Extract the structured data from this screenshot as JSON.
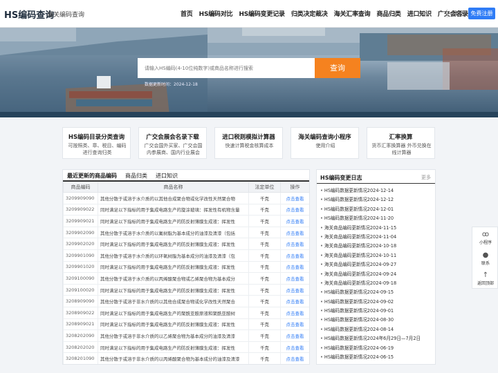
{
  "header": {
    "logo": "HS编码查询",
    "subtitle": "海关编码查询",
    "nav": [
      "首页",
      "HS编码对比",
      "HS编码变更记录",
      "归类决定裁决",
      "海关汇率查询",
      "商品归类",
      "进口知识",
      "广交会名录"
    ],
    "login": "登录",
    "register": "免费注册"
  },
  "hero": {
    "search_placeholder": "请输入HS编码(4-10位纯数字)或商品名称进行搜索",
    "search_button": "查询",
    "update_time": "数据更新时间：2024-12-18"
  },
  "cards": [
    {
      "title": "HS编码目录分类查询",
      "desc": "可按照类、章、税目、编码进行查询归类"
    },
    {
      "title": "广交会展会名录下载",
      "desc": "广交会国外买家、广交会国内参展商、国内行业展会"
    },
    {
      "title": "进口税则模拟计算器",
      "desc": "快速计算税金核算成本"
    },
    {
      "title": "海关编码查询小程序",
      "desc": "使用介绍"
    },
    {
      "title": "汇率换算",
      "desc": "货币汇率换算器 外币兑换在线计算器"
    }
  ],
  "products": {
    "tabs": [
      "最近更新的商品编码",
      "商品归类",
      "进口知识"
    ],
    "columns": [
      "商品编码",
      "商品名称",
      "法定单位",
      "操作"
    ],
    "rows": [
      {
        "code": "3209909090",
        "name": "其他分散于或溶于水介质的以其他合成聚合物或化学改性天然聚合物",
        "unit": "千克",
        "op": "点击查看"
      },
      {
        "code": "3209909022",
        "name": "同时满足以下指标的用于集成电路生产的旋涂玻璃：挥发性有机物含量",
        "unit": "千克",
        "op": "点击查看"
      },
      {
        "code": "3209909021",
        "name": "同时满足以下指标的用于集成电路生产的防反射薄膜生成液：挥发性",
        "unit": "千克",
        "op": "点击查看"
      },
      {
        "code": "3209902090",
        "name": "其他分散于或溶于水介质的以氟树脂为基本成分的油漆及清漆（包括",
        "unit": "千克",
        "op": "点击查看"
      },
      {
        "code": "3209902020",
        "name": "同时满足以下指标的用于集成电路生产的防反射薄膜生成液：挥发性",
        "unit": "千克",
        "op": "点击查看"
      },
      {
        "code": "3209901090",
        "name": "其他分散于或溶于水介质的以环氧树脂为基本成分的油漆及清漆（包",
        "unit": "千克",
        "op": "点击查看"
      },
      {
        "code": "3209901020",
        "name": "同时满足以下指标的用于集成电路生产的防反射薄膜生成液：挥发性",
        "unit": "千克",
        "op": "点击查看"
      },
      {
        "code": "3209100090",
        "name": "其他分散于或溶于水介质的以丙烯酸聚合物或乙烯聚合物为基本成分",
        "unit": "千克",
        "op": "点击查看"
      },
      {
        "code": "3209100020",
        "name": "同时满足以下指标的用于集成电路生产的防反射薄膜生成液：挥发性",
        "unit": "千克",
        "op": "点击查看"
      },
      {
        "code": "3208909090",
        "name": "其他分散于或溶于非水介质的以其他合成聚合物或化学改性天然聚合",
        "unit": "千克",
        "op": "点击查看"
      },
      {
        "code": "3208909022",
        "name": "同时满足以下指标的用于集成电路生产的聚酰亚胺原液和聚酰亚胺树",
        "unit": "千克",
        "op": "点击查看"
      },
      {
        "code": "3208909021",
        "name": "同时满足以下指标的用于集成电路生产的防反射薄膜生成液：挥发性",
        "unit": "千克",
        "op": "点击查看"
      },
      {
        "code": "3208202090",
        "name": "其他分散于或溶于非水介质的以乙烯聚合物为基本成分的油漆及清漆",
        "unit": "千克",
        "op": "点击查看"
      },
      {
        "code": "3208202020",
        "name": "同时满足以下指标的用于集成电路生产的防反射薄膜生成液：挥发性",
        "unit": "千克",
        "op": "点击查看"
      },
      {
        "code": "3208201090",
        "name": "其他分散于或溶于非水介质的以丙烯酸聚合物为基本成分的油漆及清漆",
        "unit": "千克",
        "op": "点击查看"
      }
    ]
  },
  "changelog": {
    "title": "HS编码变更日志",
    "more": "更多",
    "items": [
      "HS编码数据更新情况2024-12-14",
      "HS编码数据更新情况2024-12-12",
      "HS编码数据更新情况2024-12-01",
      "HS编码数据更新情况2024-11-20",
      "海关商品编码更新情况2024-11-15",
      "海关商品编码更新情况2024-11-04",
      "海关商品编码更新情况2024-10-18",
      "海关商品编码更新情况2024-10-11",
      "海关商品编码更新情况2024-09-27",
      "海关商品编码更新情况2024-09-24",
      "海关商品编码更新情况2024-09-18",
      "HS编码数据更新情况2024-09-15",
      "HS编码数据更新情况2024-09-02",
      "HS编码数据更新情况2024-09-01",
      "HS编码数据更新情况2024-08-30",
      "HS编码数据更新情况2024-08-14",
      "HS编码数据更新情况2024年6月29日—7月2日",
      "HS编码数据更新情况2024-06-19",
      "HS编码数据更新情况2024-06-15"
    ]
  },
  "float_bar": {
    "miniprogram": "小程序",
    "contact": "联系",
    "back_top": "返回顶部"
  }
}
